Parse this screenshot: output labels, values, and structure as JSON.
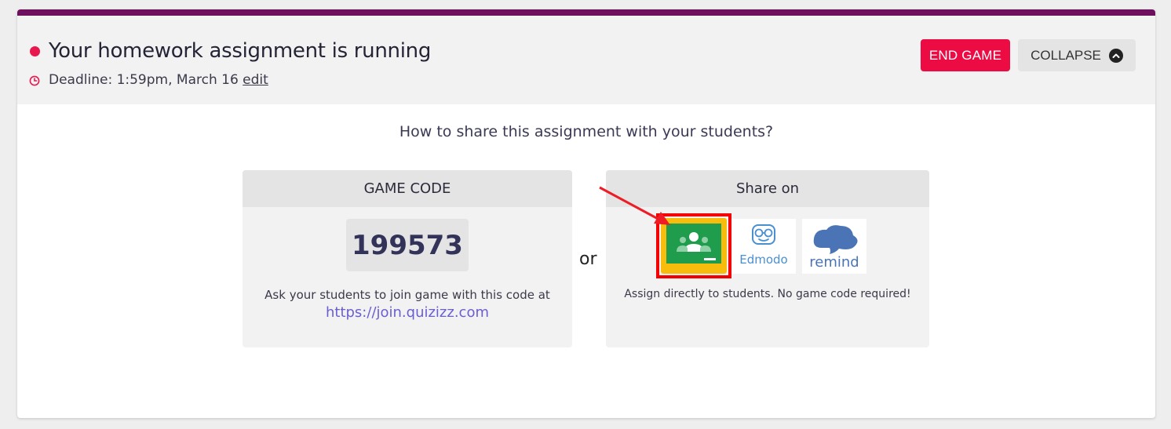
{
  "header": {
    "title": "Your homework assignment is running",
    "deadline_text": "Deadline: 1:59pm, March 16",
    "edit_link": "edit",
    "end_game_label": "END GAME",
    "collapse_label": "COLLAPSE"
  },
  "share": {
    "question": "How to share this assignment with your students?",
    "or_label": "or",
    "game_code": {
      "heading": "GAME CODE",
      "code": "199573",
      "instruction": "Ask your students to join game with this code at",
      "link": "https://join.quizizz.com"
    },
    "share_on": {
      "heading": "Share on",
      "platforms": [
        {
          "name": "Google Classroom",
          "icon": "google-classroom-icon"
        },
        {
          "name": "Edmodo",
          "icon": "edmodo-icon"
        },
        {
          "name": "remind",
          "icon": "remind-icon"
        }
      ],
      "note": "Assign directly to students. No game code required!"
    }
  },
  "colors": {
    "accent_bar": "#6e0f5e",
    "live_dot": "#e8174e",
    "end_button": "#ec0b43",
    "link": "#6a5fd1",
    "highlight": "#f40000",
    "classroom_green": "#1f9c4c",
    "classroom_yellow": "#f8bc0c",
    "remind_blue": "#4a74b6"
  }
}
